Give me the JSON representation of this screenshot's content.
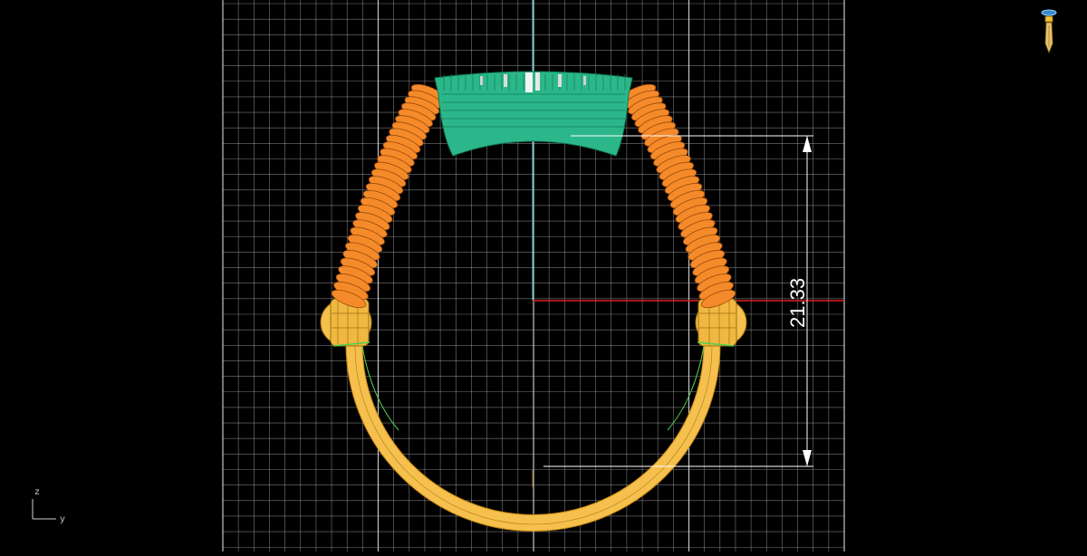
{
  "viewport": {
    "view": "front",
    "background_color": "#000000",
    "grid_color": "#d9d9d9"
  },
  "dimension": {
    "value": "21.33"
  },
  "axes": {
    "vertical_axis_label": "z",
    "horizontal_axis_label": "y",
    "x_axis_color": "#e02020",
    "z_axis_color": "#3fd6d6"
  },
  "model": {
    "band_color": "#f5c04d",
    "shoulder_color": "#f58a2a",
    "head_color": "#2bb78a",
    "wire_color": "#2a1a40"
  },
  "icons": {
    "corner_tool": "pen-tool-icon"
  }
}
